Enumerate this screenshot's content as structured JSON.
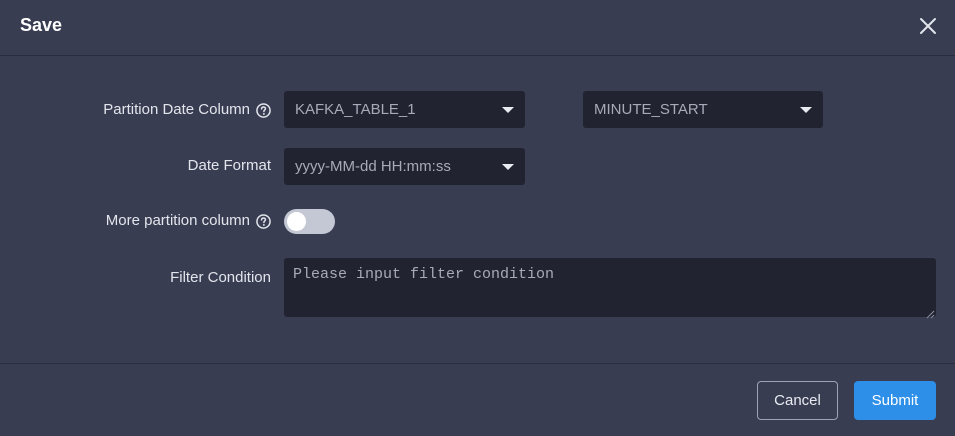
{
  "dialog": {
    "title": "Save",
    "close_icon": "close-icon"
  },
  "form": {
    "partition_date_column": {
      "label": "Partition Date Column",
      "help_icon": "question-circle-icon",
      "table_value": "KAFKA_TABLE_1",
      "column_value": "MINUTE_START"
    },
    "date_format": {
      "label": "Date Format",
      "value": "yyyy-MM-dd HH:mm:ss"
    },
    "more_partition_column": {
      "label": "More partition column",
      "help_icon": "question-circle-icon",
      "enabled": false
    },
    "filter_condition": {
      "label": "Filter Condition",
      "value": "",
      "placeholder": "Please input filter condition"
    }
  },
  "footer": {
    "cancel_label": "Cancel",
    "submit_label": "Submit"
  },
  "colors": {
    "background": "#393d52",
    "input_bg": "#212330",
    "primary": "#2d8fe8",
    "toggle_off": "#c4c8d4"
  }
}
